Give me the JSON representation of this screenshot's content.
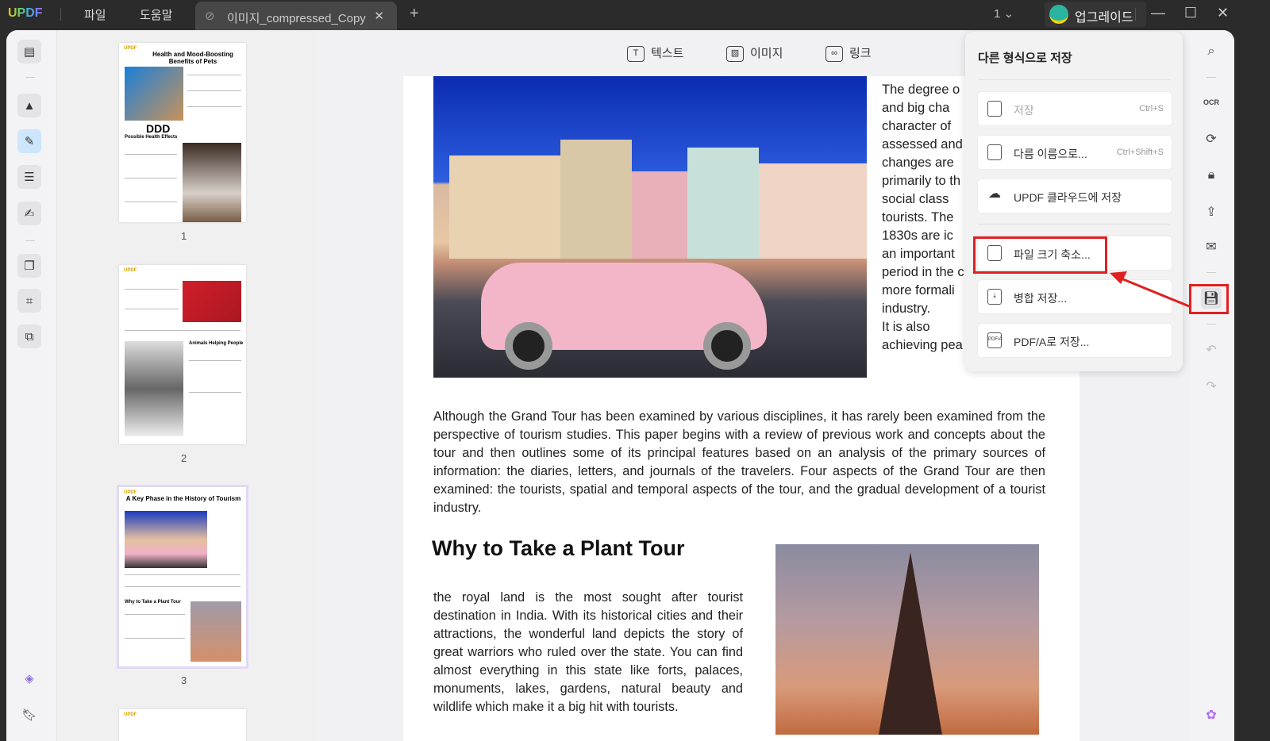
{
  "titlebar": {
    "logo": "UPDF",
    "menus": [
      "파일",
      "도움말"
    ],
    "tab_title": "이미지_compressed_Copy",
    "page_indicator": "1",
    "upgrade": "업그레이드"
  },
  "toolbar": {
    "text": "텍스트",
    "image": "이미지",
    "link": "링크"
  },
  "thumbnails": [
    {
      "page": "1",
      "title": "Health and Mood-Boosting Benefits of Pets",
      "overlay": "DDD",
      "sub": "Possible Health Effects"
    },
    {
      "page": "2",
      "sub": "Animals Helping People"
    },
    {
      "page": "3",
      "title": "A Key Phase in the History of Tourism",
      "sub": "Why to Take a Plant Tour"
    }
  ],
  "document": {
    "right_column": [
      "The degree o",
      "and big cha",
      "character of",
      "assessed and",
      "changes are",
      "primarily to th",
      "social class",
      "tourists. The",
      "1830s are ic",
      "an important",
      "period in the c",
      "more formali",
      "industry.",
      "It is also",
      "achieving pea"
    ],
    "paragraph": "Although the Grand Tour has been examined by various disciplines, it has rarely been examined from the perspective of tourism studies. This paper begins with a review of previous work and concepts about the tour and then outlines some of its principal features based on an analysis of the primary sources of information: the diaries, letters, and journals of the travelers. Four aspects of the Grand Tour are then examined: the tourists, spatial and temporal aspects of the tour, and the gradual development of a tourist industry.",
    "heading": "Why to Take a Plant Tour",
    "left_column": "the royal land is the most sought after tourist destination in India. With its historical cities and their attractions, the wonderful land depicts the story of great warriors who ruled over the state. You can find almost everything in this state like forts, palaces, monuments, lakes, gardens, natural beauty and wildlife which make it a big hit with tourists."
  },
  "save_menu": {
    "title": "다른 형식으로 저장",
    "items": [
      {
        "label": "저장",
        "shortcut": "Ctrl+S",
        "icon": "save-icon",
        "disabled": true
      },
      {
        "label": "다름 이름으로...",
        "shortcut": "Ctrl+Shift+S",
        "icon": "save-as-icon"
      },
      {
        "label": "UPDF 클라우드에 저장",
        "icon": "cloud-upload-icon"
      },
      {
        "label": "파일 크기 축소...",
        "icon": "compress-icon",
        "highlighted": true
      },
      {
        "label": "병합 저장...",
        "icon": "flatten-icon"
      },
      {
        "label": "PDF/A로 저장...",
        "icon": "pdfa-icon",
        "icon_text": "PDF/A"
      }
    ]
  },
  "colors": {
    "highlight": "#e02020",
    "accent": "#cde6fb"
  }
}
